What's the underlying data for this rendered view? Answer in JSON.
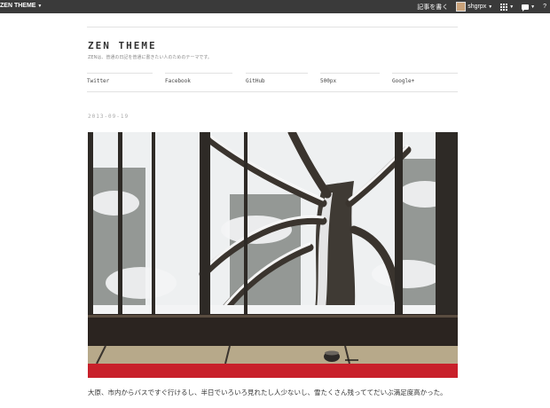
{
  "topbar": {
    "site_name": "ZEN THEME",
    "write_post": "記事を書く",
    "username": "shgrpx"
  },
  "site": {
    "title": "ZEN THEME",
    "tagline": "ZENは、普通の日記を普通に書きたい人のためのテーマです。"
  },
  "nav": [
    {
      "label": "Twitter"
    },
    {
      "label": "Facebook"
    },
    {
      "label": "GitHub"
    },
    {
      "label": "500px"
    },
    {
      "label": "Google+"
    }
  ],
  "post": {
    "date": "2013-09-19",
    "text": "大原、市内からバスですぐ行けるし、半日でいろいろ見れたし人少ないし、雪たくさん残っててだいぶ満足度高かった。"
  },
  "colors": {
    "topbar_bg": "#3a3a3a",
    "tatami_red": "#c8202a",
    "wood_dark": "#2b2420"
  }
}
